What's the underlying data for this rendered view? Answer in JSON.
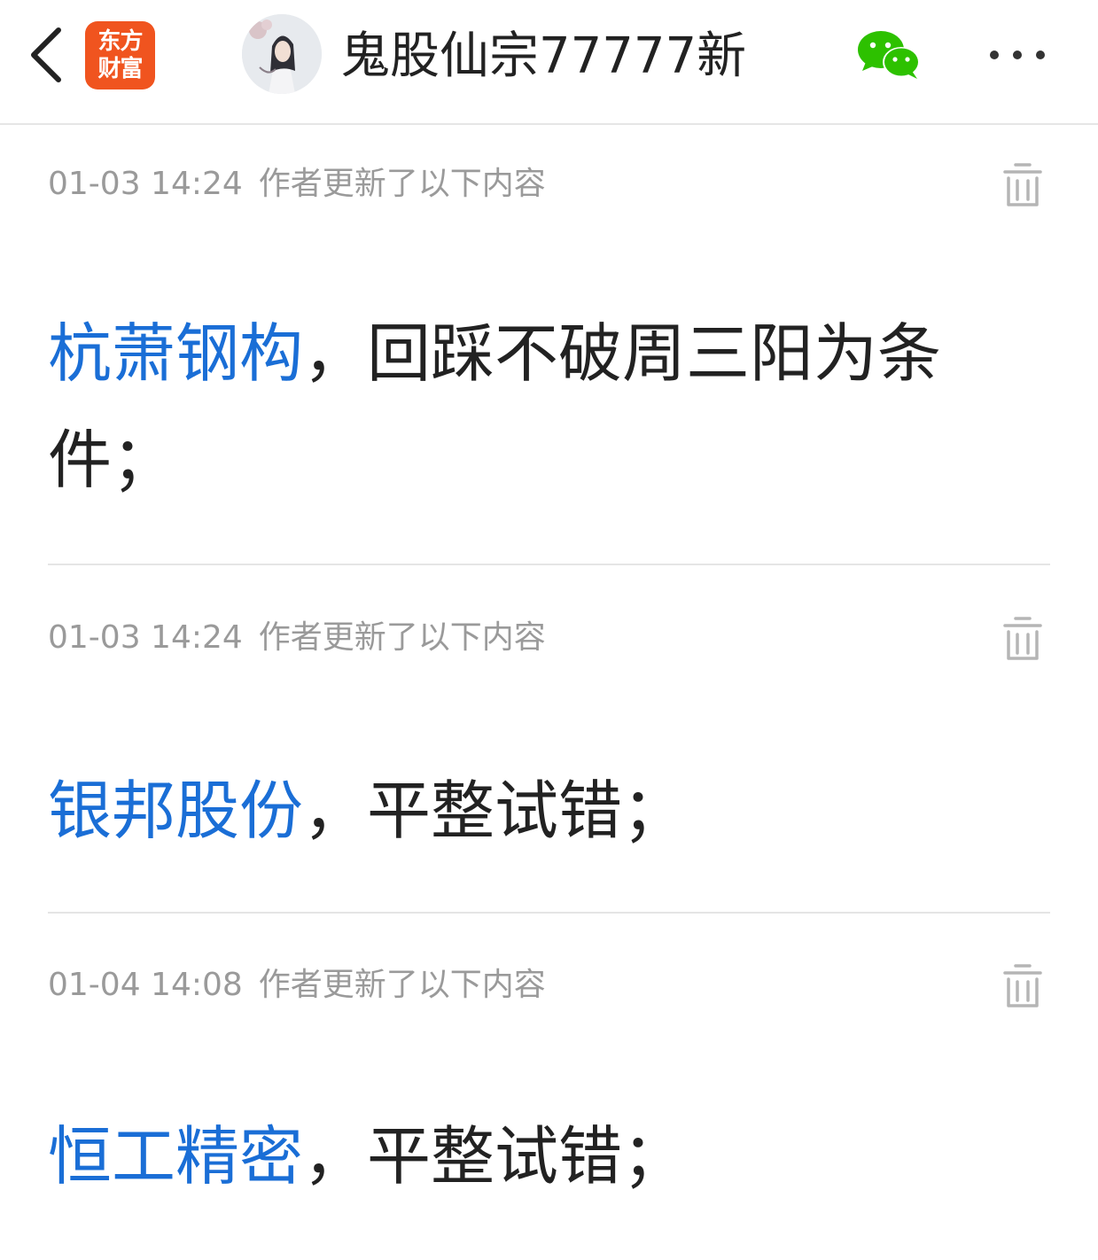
{
  "header": {
    "back_icon": "chevron-left-icon",
    "logo_line1": "东方",
    "logo_line2": "财富",
    "logo_color": "#f0541f",
    "title": "鬼股仙宗77777新",
    "share_icon": "wechat-icon",
    "share_icon_color": "#2dc100",
    "more_icon": "more-dots-icon"
  },
  "link_color": "#1a6ed6",
  "entries": [
    {
      "time": "01-03 14:24",
      "meta": "作者更新了以下内容",
      "stock": "杭萧钢构",
      "text": "，回踩不破周三阳为条件；",
      "delete_icon": "trash-icon"
    },
    {
      "time": "01-03 14:24",
      "meta": "作者更新了以下内容",
      "stock": "银邦股份",
      "text": "，平整试错；",
      "delete_icon": "trash-icon"
    },
    {
      "time": "01-04 14:08",
      "meta": "作者更新了以下内容",
      "stock": "恒工精密",
      "text": "，平整试错；",
      "delete_icon": "trash-icon"
    }
  ]
}
